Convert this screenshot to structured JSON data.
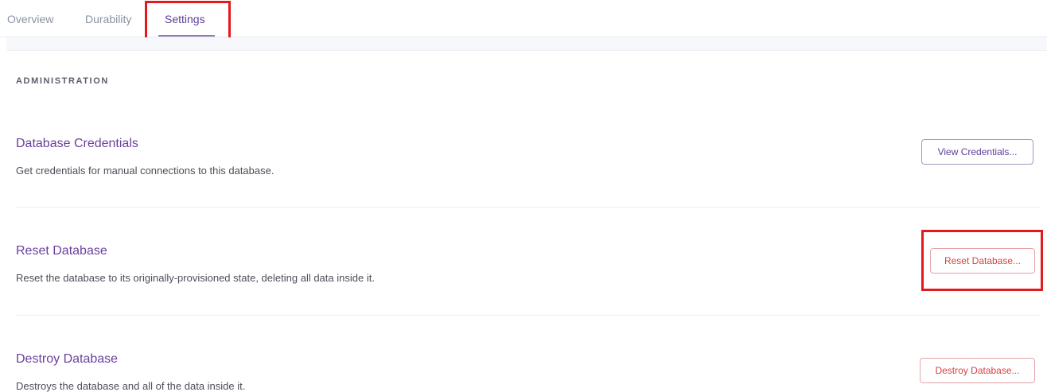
{
  "tabs": [
    {
      "label": "Overview"
    },
    {
      "label": "Durability"
    },
    {
      "label": "Settings",
      "active": true
    }
  ],
  "section": {
    "heading": "ADMINISTRATION"
  },
  "rows": [
    {
      "title": "Database Credentials",
      "description": "Get credentials for manual connections to this database.",
      "button": "View Credentials..."
    },
    {
      "title": "Reset Database",
      "description": "Reset the database to its originally-provisioned state, deleting all data inside it.",
      "button": "Reset Database..."
    },
    {
      "title": "Destroy Database",
      "description": "Destroys the database and all of the data inside it.",
      "button": "Destroy Database..."
    }
  ],
  "colors": {
    "accent": "#5d3d99",
    "danger": "#d64242",
    "annotation": "#e2191f"
  }
}
